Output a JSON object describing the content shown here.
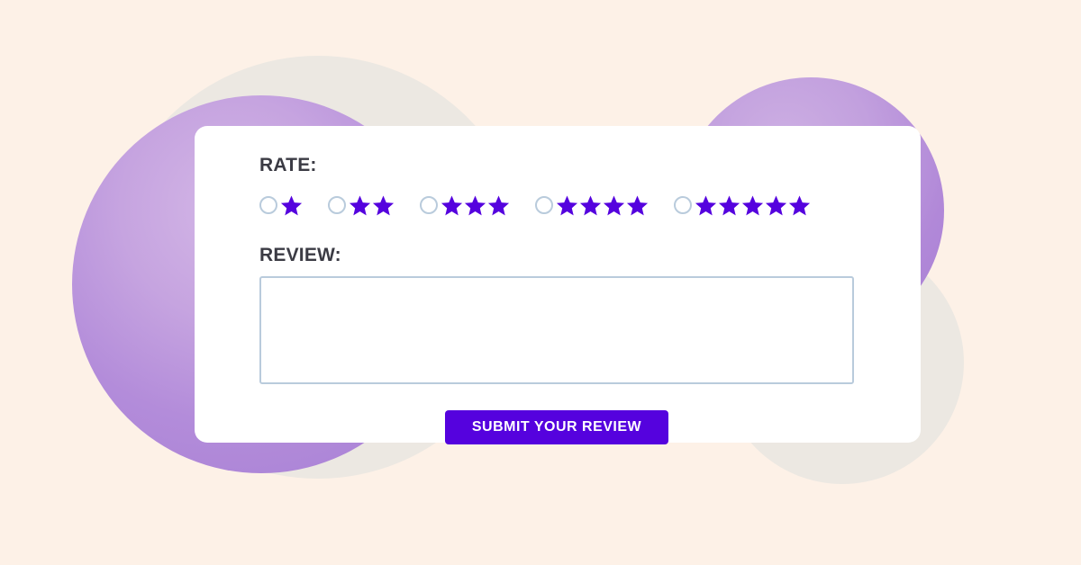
{
  "theme": {
    "background_color": "#FDF1E7",
    "card_color": "#FFFFFF",
    "accent_color": "#5502DE",
    "star_color": "#5502DE",
    "label_color": "#3B3B44",
    "input_border_color": "#B9CBDC",
    "decor_purple_color": "#B38CDA",
    "decor_beige_color": "#ECE8E2"
  },
  "form": {
    "rate": {
      "label": "RATE:",
      "star_icon": "star-icon",
      "options": [
        {
          "value": 1,
          "stars": 1,
          "selected": false
        },
        {
          "value": 2,
          "stars": 2,
          "selected": false
        },
        {
          "value": 3,
          "stars": 3,
          "selected": false
        },
        {
          "value": 4,
          "stars": 4,
          "selected": false
        },
        {
          "value": 5,
          "stars": 5,
          "selected": false
        }
      ]
    },
    "review": {
      "label": "REVIEW:",
      "value": "",
      "placeholder": ""
    },
    "submit": {
      "label": "SUBMIT YOUR REVIEW"
    }
  }
}
